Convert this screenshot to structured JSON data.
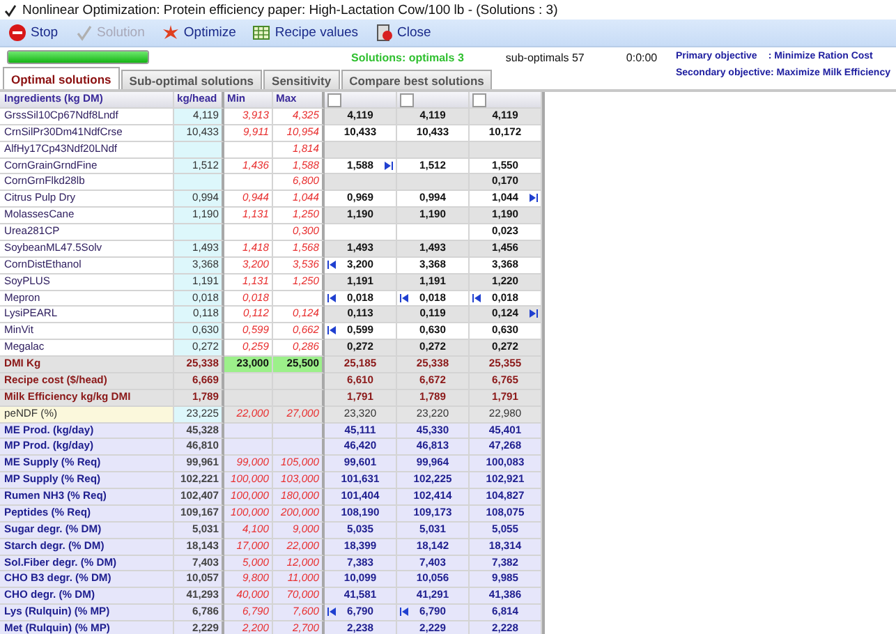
{
  "window": {
    "title": "Nonlinear Optimization:  Protein efficiency paper: High-Lactation Cow/100 lb - (Solutions : 3)"
  },
  "toolbar": [
    {
      "label": "Stop",
      "kind": "stop",
      "disabled": false
    },
    {
      "label": "Solution",
      "kind": "solution",
      "disabled": true
    },
    {
      "label": "Optimize",
      "kind": "optimize",
      "disabled": false
    },
    {
      "label": "Recipe values",
      "kind": "recipe",
      "disabled": false
    },
    {
      "label": "Close",
      "kind": "close",
      "disabled": false
    }
  ],
  "progress": {
    "level": 1
  },
  "status": {
    "solutions": "Solutions: optimals 3",
    "suboptimals": "sub-optimals 57",
    "elapsed": "0:0:00"
  },
  "objectives": {
    "primary_label": "Primary objective",
    "primary_value": ": Minimize Ration Cost",
    "secondary": "Secondary objective: Maximize Milk Efficiency"
  },
  "tabs": [
    {
      "label": "Optimal solutions",
      "selected": true
    },
    {
      "label": "Sub-optimal solutions",
      "selected": false
    },
    {
      "label": "Sensitivity",
      "selected": false
    },
    {
      "label": "Compare best solutions",
      "selected": false
    }
  ],
  "table": {
    "columns": [
      "Ingredients (kg DM)",
      "kg/head",
      "Min",
      "Max"
    ],
    "solution_columns": [
      {
        "checked": false
      },
      {
        "checked": false
      },
      {
        "checked": false
      }
    ],
    "rows": [
      {
        "kind": "ingredient",
        "name": "GrssSil10Cp67Ndf8Lndf",
        "kg_head": "4,119",
        "min": "3,913",
        "max": "4,325",
        "solutions": [
          {
            "value": "4,119",
            "at_min": false,
            "at_max": false
          },
          {
            "value": "4,119",
            "at_min": false,
            "at_max": false
          },
          {
            "value": "4,119",
            "at_min": false,
            "at_max": false
          }
        ]
      },
      {
        "kind": "ingredient",
        "name": "CrnSilPr30Dm41NdfCrse",
        "kg_head": "10,433",
        "min": "9,911",
        "max": "10,954",
        "solutions": [
          {
            "value": "10,433",
            "at_min": false,
            "at_max": false
          },
          {
            "value": "10,433",
            "at_min": false,
            "at_max": false
          },
          {
            "value": "10,172",
            "at_min": false,
            "at_max": false
          }
        ]
      },
      {
        "kind": "ingredient",
        "name": "AlfHy17Cp43Ndf20LNdf",
        "max": "1,814",
        "solutions": [
          {
            "at_min": false,
            "at_max": false
          },
          {
            "at_min": false,
            "at_max": false
          },
          {
            "at_min": false,
            "at_max": false
          }
        ]
      },
      {
        "kind": "ingredient",
        "name": "CornGrainGrndFine",
        "kg_head": "1,512",
        "min": "1,436",
        "max": "1,588",
        "solutions": [
          {
            "value": "1,588",
            "at_min": false,
            "at_max": true
          },
          {
            "value": "1,512",
            "at_min": false,
            "at_max": false
          },
          {
            "value": "1,550",
            "at_min": false,
            "at_max": false
          }
        ]
      },
      {
        "kind": "ingredient",
        "name": "CornGrnFlkd28lb",
        "max": "6,800",
        "solutions": [
          {
            "at_min": false,
            "at_max": false
          },
          {
            "at_min": false,
            "at_max": false
          },
          {
            "value": "0,170",
            "at_min": false,
            "at_max": false
          }
        ]
      },
      {
        "kind": "ingredient",
        "name": "Citrus Pulp Dry",
        "kg_head": "0,994",
        "min": "0,944",
        "max": "1,044",
        "solutions": [
          {
            "value": "0,969",
            "at_min": false,
            "at_max": false
          },
          {
            "value": "0,994",
            "at_min": false,
            "at_max": false
          },
          {
            "value": "1,044",
            "at_min": false,
            "at_max": true
          }
        ]
      },
      {
        "kind": "ingredient",
        "name": "MolassesCane",
        "kg_head": "1,190",
        "min": "1,131",
        "max": "1,250",
        "solutions": [
          {
            "value": "1,190",
            "at_min": false,
            "at_max": false
          },
          {
            "value": "1,190",
            "at_min": false,
            "at_max": false
          },
          {
            "value": "1,190",
            "at_min": false,
            "at_max": false
          }
        ]
      },
      {
        "kind": "ingredient",
        "name": "Urea281CP",
        "max": "0,300",
        "solutions": [
          {
            "at_min": false,
            "at_max": false
          },
          {
            "at_min": false,
            "at_max": false
          },
          {
            "value": "0,023",
            "at_min": false,
            "at_max": false
          }
        ]
      },
      {
        "kind": "ingredient",
        "name": "SoybeanML47.5Solv",
        "kg_head": "1,493",
        "min": "1,418",
        "max": "1,568",
        "solutions": [
          {
            "value": "1,493",
            "at_min": false,
            "at_max": false
          },
          {
            "value": "1,493",
            "at_min": false,
            "at_max": false
          },
          {
            "value": "1,456",
            "at_min": false,
            "at_max": false
          }
        ]
      },
      {
        "kind": "ingredient",
        "name": "CornDistEthanol",
        "kg_head": "3,368",
        "min": "3,200",
        "max": "3,536",
        "solutions": [
          {
            "value": "3,200",
            "at_min": true,
            "at_max": false
          },
          {
            "value": "3,368",
            "at_min": false,
            "at_max": false
          },
          {
            "value": "3,368",
            "at_min": false,
            "at_max": false
          }
        ]
      },
      {
        "kind": "ingredient",
        "name": "SoyPLUS",
        "kg_head": "1,191",
        "min": "1,131",
        "max": "1,250",
        "solutions": [
          {
            "value": "1,191",
            "at_min": false,
            "at_max": false
          },
          {
            "value": "1,191",
            "at_min": false,
            "at_max": false
          },
          {
            "value": "1,220",
            "at_min": false,
            "at_max": false
          }
        ]
      },
      {
        "kind": "ingredient",
        "name": "Mepron",
        "kg_head": "0,018",
        "min": "0,018",
        "solutions": [
          {
            "value": "0,018",
            "at_min": true,
            "at_max": false
          },
          {
            "value": "0,018",
            "at_min": true,
            "at_max": false
          },
          {
            "value": "0,018",
            "at_min": true,
            "at_max": false
          }
        ]
      },
      {
        "kind": "ingredient",
        "name": "LysiPEARL",
        "kg_head": "0,118",
        "min": "0,112",
        "max": "0,124",
        "solutions": [
          {
            "value": "0,113",
            "at_min": false,
            "at_max": false
          },
          {
            "value": "0,119",
            "at_min": false,
            "at_max": false
          },
          {
            "value": "0,124",
            "at_min": false,
            "at_max": true
          }
        ]
      },
      {
        "kind": "ingredient",
        "name": "MinVit",
        "kg_head": "0,630",
        "min": "0,599",
        "max": "0,662",
        "solutions": [
          {
            "value": "0,599",
            "at_min": true,
            "at_max": false
          },
          {
            "value": "0,630",
            "at_min": false,
            "at_max": false
          },
          {
            "value": "0,630",
            "at_min": false,
            "at_max": false
          }
        ]
      },
      {
        "kind": "ingredient",
        "name": "Megalac",
        "kg_head": "0,272",
        "min": "0,259",
        "max": "0,286",
        "solutions": [
          {
            "value": "0,272",
            "at_min": false,
            "at_max": false
          },
          {
            "value": "0,272",
            "at_min": false,
            "at_max": false
          },
          {
            "value": "0,272",
            "at_min": false,
            "at_max": false
          }
        ]
      },
      {
        "kind": "total",
        "name": "DMI Kg",
        "kg_head": "25,338",
        "min": "23,000",
        "max": "25,500",
        "limits_met": true,
        "solutions": [
          {
            "value": "25,185",
            "at_min": false,
            "at_max": false
          },
          {
            "value": "25,338",
            "at_min": false,
            "at_max": false
          },
          {
            "value": "25,355",
            "at_min": false,
            "at_max": false
          }
        ]
      },
      {
        "kind": "total",
        "name": "Recipe cost ($/head)",
        "kg_head": "6,669",
        "limits_met": false,
        "solutions": [
          {
            "value": "6,610",
            "at_min": false,
            "at_max": false
          },
          {
            "value": "6,672",
            "at_min": false,
            "at_max": false
          },
          {
            "value": "6,765",
            "at_min": false,
            "at_max": false
          }
        ]
      },
      {
        "kind": "total",
        "name": "Milk Efficiency kg/kg DMI",
        "kg_head": "1,789",
        "limits_met": false,
        "solutions": [
          {
            "value": "1,791",
            "at_min": false,
            "at_max": false
          },
          {
            "value": "1,789",
            "at_min": false,
            "at_max": false
          },
          {
            "value": "1,791",
            "at_min": false,
            "at_max": false
          }
        ]
      },
      {
        "kind": "target",
        "name": "peNDF (%)",
        "kg_head": "23,225",
        "min": "22,000",
        "max": "27,000",
        "solutions": [
          {
            "value": "23,320",
            "at_min": false,
            "at_max": false
          },
          {
            "value": "23,220",
            "at_min": false,
            "at_max": false
          },
          {
            "value": "22,980",
            "at_min": false,
            "at_max": false
          }
        ]
      },
      {
        "kind": "nutrient",
        "name": "ME Prod. (kg/day)",
        "kg_head": "45,328",
        "solutions": [
          {
            "value": "45,111",
            "at_min": false,
            "at_max": false
          },
          {
            "value": "45,330",
            "at_min": false,
            "at_max": false
          },
          {
            "value": "45,401",
            "at_min": false,
            "at_max": false
          }
        ]
      },
      {
        "kind": "nutrient",
        "name": "MP Prod. (kg/day)",
        "kg_head": "46,810",
        "solutions": [
          {
            "value": "46,420",
            "at_min": false,
            "at_max": false
          },
          {
            "value": "46,813",
            "at_min": false,
            "at_max": false
          },
          {
            "value": "47,268",
            "at_min": false,
            "at_max": false
          }
        ]
      },
      {
        "kind": "nutrient",
        "name": "ME Supply (% Req)",
        "kg_head": "99,961",
        "min": "99,000",
        "max": "105,000",
        "solutions": [
          {
            "value": "99,601",
            "at_min": false,
            "at_max": false
          },
          {
            "value": "99,964",
            "at_min": false,
            "at_max": false
          },
          {
            "value": "100,083",
            "at_min": false,
            "at_max": false
          }
        ]
      },
      {
        "kind": "nutrient",
        "name": "MP Supply (% Req)",
        "kg_head": "102,221",
        "min": "100,000",
        "max": "103,000",
        "solutions": [
          {
            "value": "101,631",
            "at_min": false,
            "at_max": false
          },
          {
            "value": "102,225",
            "at_min": false,
            "at_max": false
          },
          {
            "value": "102,921",
            "at_min": false,
            "at_max": false
          }
        ]
      },
      {
        "kind": "nutrient",
        "name": "Rumen NH3 (% Req)",
        "kg_head": "102,407",
        "min": "100,000",
        "max": "180,000",
        "solutions": [
          {
            "value": "101,404",
            "at_min": false,
            "at_max": false
          },
          {
            "value": "102,414",
            "at_min": false,
            "at_max": false
          },
          {
            "value": "104,827",
            "at_min": false,
            "at_max": false
          }
        ]
      },
      {
        "kind": "nutrient",
        "name": "Peptides (% Req)",
        "kg_head": "109,167",
        "min": "100,000",
        "max": "200,000",
        "solutions": [
          {
            "value": "108,190",
            "at_min": false,
            "at_max": false
          },
          {
            "value": "109,173",
            "at_min": false,
            "at_max": false
          },
          {
            "value": "108,075",
            "at_min": false,
            "at_max": false
          }
        ]
      },
      {
        "kind": "nutrient",
        "name": "Sugar degr. (% DM)",
        "kg_head": "5,031",
        "min": "4,100",
        "max": "9,000",
        "solutions": [
          {
            "value": "5,035",
            "at_min": false,
            "at_max": false
          },
          {
            "value": "5,031",
            "at_min": false,
            "at_max": false
          },
          {
            "value": "5,055",
            "at_min": false,
            "at_max": false
          }
        ]
      },
      {
        "kind": "nutrient",
        "name": "Starch degr. (% DM)",
        "kg_head": "18,143",
        "min": "17,000",
        "max": "22,000",
        "solutions": [
          {
            "value": "18,399",
            "at_min": false,
            "at_max": false
          },
          {
            "value": "18,142",
            "at_min": false,
            "at_max": false
          },
          {
            "value": "18,314",
            "at_min": false,
            "at_max": false
          }
        ]
      },
      {
        "kind": "nutrient",
        "name": "Sol.Fiber degr. (% DM)",
        "kg_head": "7,403",
        "min": "5,000",
        "max": "12,000",
        "solutions": [
          {
            "value": "7,383",
            "at_min": false,
            "at_max": false
          },
          {
            "value": "7,403",
            "at_min": false,
            "at_max": false
          },
          {
            "value": "7,382",
            "at_min": false,
            "at_max": false
          }
        ]
      },
      {
        "kind": "nutrient",
        "name": "CHO B3 degr. (% DM)",
        "kg_head": "10,057",
        "min": "9,800",
        "max": "11,000",
        "solutions": [
          {
            "value": "10,099",
            "at_min": false,
            "at_max": false
          },
          {
            "value": "10,056",
            "at_min": false,
            "at_max": false
          },
          {
            "value": "9,985",
            "at_min": false,
            "at_max": false
          }
        ]
      },
      {
        "kind": "nutrient",
        "name": "CHO degr. (% DM)",
        "kg_head": "41,293",
        "min": "40,000",
        "max": "70,000",
        "solutions": [
          {
            "value": "41,581",
            "at_min": false,
            "at_max": false
          },
          {
            "value": "41,291",
            "at_min": false,
            "at_max": false
          },
          {
            "value": "41,386",
            "at_min": false,
            "at_max": false
          }
        ]
      },
      {
        "kind": "nutrient",
        "name": "Lys (Rulquin) (% MP)",
        "kg_head": "6,786",
        "min": "6,790",
        "max": "7,600",
        "solutions": [
          {
            "value": "6,790",
            "at_min": true,
            "at_max": false
          },
          {
            "value": "6,790",
            "at_min": true,
            "at_max": false
          },
          {
            "value": "6,814",
            "at_min": false,
            "at_max": false
          }
        ]
      },
      {
        "kind": "nutrient",
        "name": "Met (Rulquin) (% MP)",
        "kg_head": "2,229",
        "min": "2,200",
        "max": "2,700",
        "solutions": [
          {
            "value": "2,238",
            "at_min": false,
            "at_max": false
          },
          {
            "value": "2,229",
            "at_min": false,
            "at_max": false
          },
          {
            "value": "2,228",
            "at_min": false,
            "at_max": false
          }
        ]
      }
    ]
  }
}
